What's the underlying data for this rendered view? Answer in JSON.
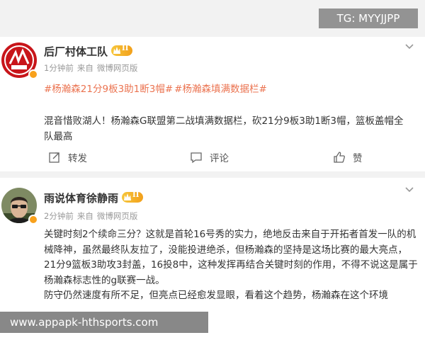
{
  "watermark": {
    "tg": "TG: MYYJJPP",
    "url": "www.appapk-hthsports.com"
  },
  "post1": {
    "author": "后厂村体工队",
    "level": "II",
    "time": "1分钟前",
    "source": "来自",
    "client": "微博网页版",
    "hashtags": [
      "#杨瀚森21分9板3助1断3帽#",
      "#杨瀚森填满数据栏#"
    ],
    "text": "混音惜败湖人！杨瀚森G联盟第二战填满数据栏，砍21分9板3助1断3帽，篮板盖帽全队最高",
    "actions": {
      "repost": "转发",
      "comment": "评论",
      "like": "赞"
    }
  },
  "post2": {
    "author": "雨说体育徐静雨",
    "level": "II",
    "time": "2分钟前",
    "source": "来自",
    "client": "微博网页版",
    "paragraph1": "关键时刻2个续命三分？这就是首轮16号秀的实力，绝地反击来自于开拓者首发一队的机械降神，虽然最终队友拉了，没能投进绝杀，但杨瀚森的坚持是这场比赛的最大亮点，21分9篮板3助攻3封盖，16投8中，这种发挥再结合关键时刻的作用，不得不说这是属于杨瀚森标志性的g联赛一战。",
    "paragraph2": "防守仍然速度有所不足，但亮点已经愈发显眼，看着这个趋势，杨瀚森在这个环境"
  },
  "colors": {
    "hashtag": "#eb7350",
    "level_badge": "#f2a01b",
    "meta": "#999999"
  }
}
